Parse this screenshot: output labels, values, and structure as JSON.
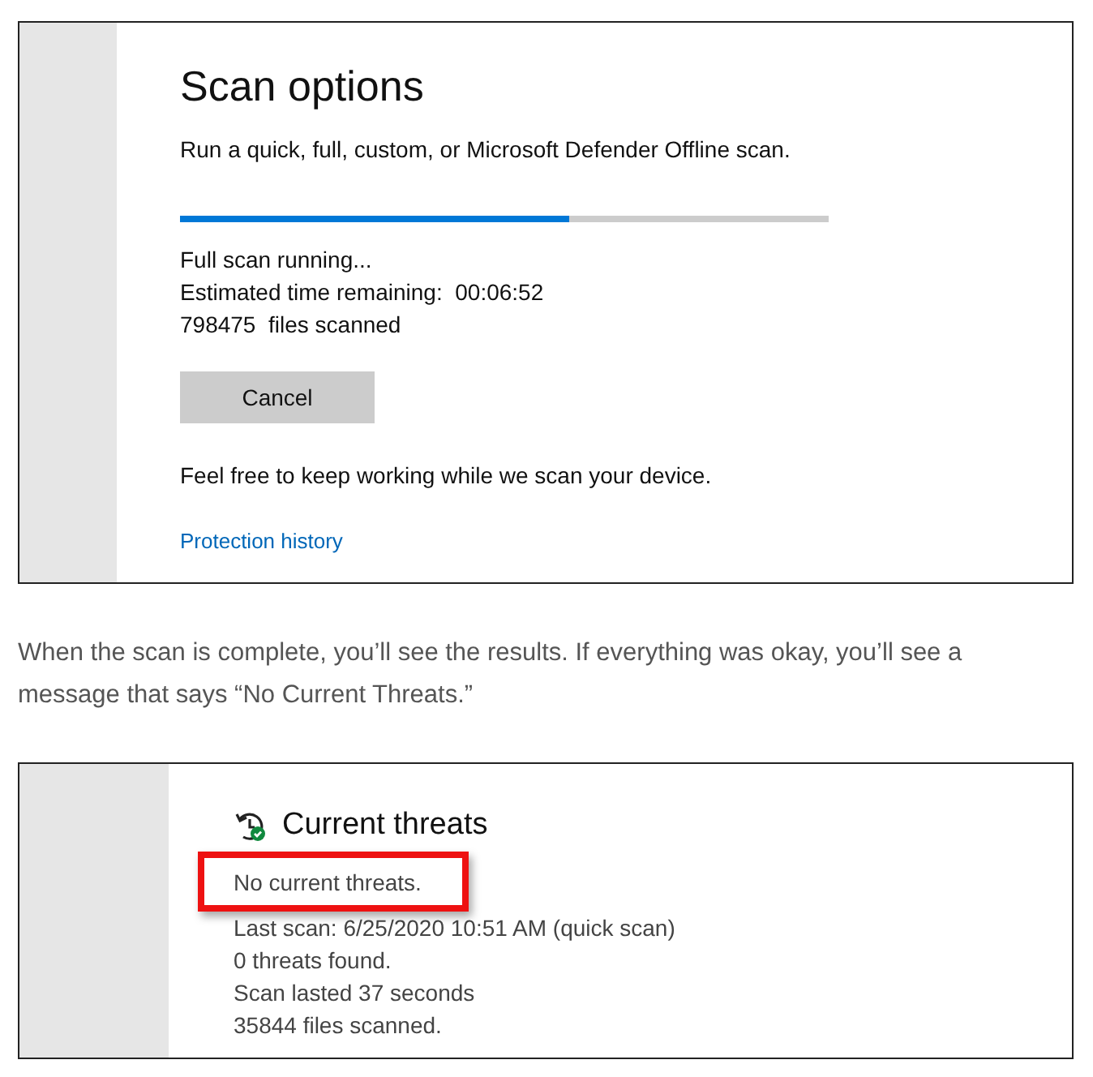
{
  "scan_options": {
    "title": "Scan options",
    "subtitle": "Run a quick, full, custom, or Microsoft Defender Offline scan.",
    "progress": {
      "level": 0.6
    },
    "status_lines": [
      "Full scan running...",
      "Estimated time remaining:  00:06:52",
      "798475  files scanned"
    ],
    "cancel_button": "Cancel",
    "note": "Feel free to keep working while we scan your device.",
    "link": "Protection history"
  },
  "article_text": "When the scan is complete, you’ll see the results. If everything was okay, you’ll see a message that says “No Current Threats.”",
  "current_threats": {
    "title": "Current threats",
    "status": {
      "text": "No current threats.",
      "highlighted": true
    },
    "details": [
      "Last scan: 6/25/2020 10:51 AM (quick scan)",
      "0 threats found.",
      "Scan lasted 37 seconds",
      "35844 files scanned."
    ]
  }
}
